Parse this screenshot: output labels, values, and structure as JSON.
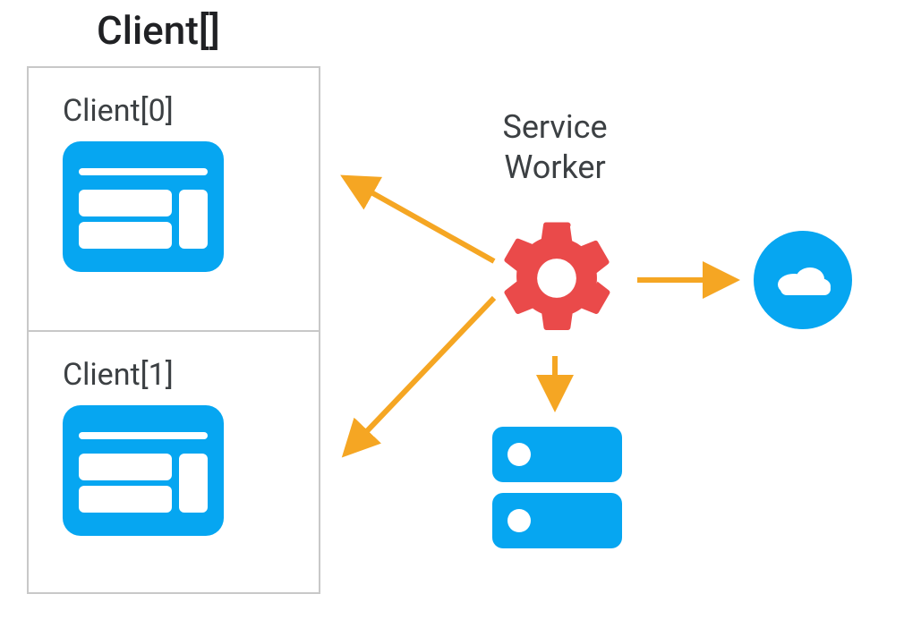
{
  "title": "Client[]",
  "clients": [
    {
      "label": "Client[0]"
    },
    {
      "label": "Client[1]"
    }
  ],
  "service_worker": {
    "line1": "Service",
    "line2": "Worker"
  },
  "colors": {
    "blue": "#06a6f1",
    "red": "#ea4a4a",
    "orange": "#f5a623",
    "border": "#c8c8c8",
    "text": "#3c4043"
  }
}
